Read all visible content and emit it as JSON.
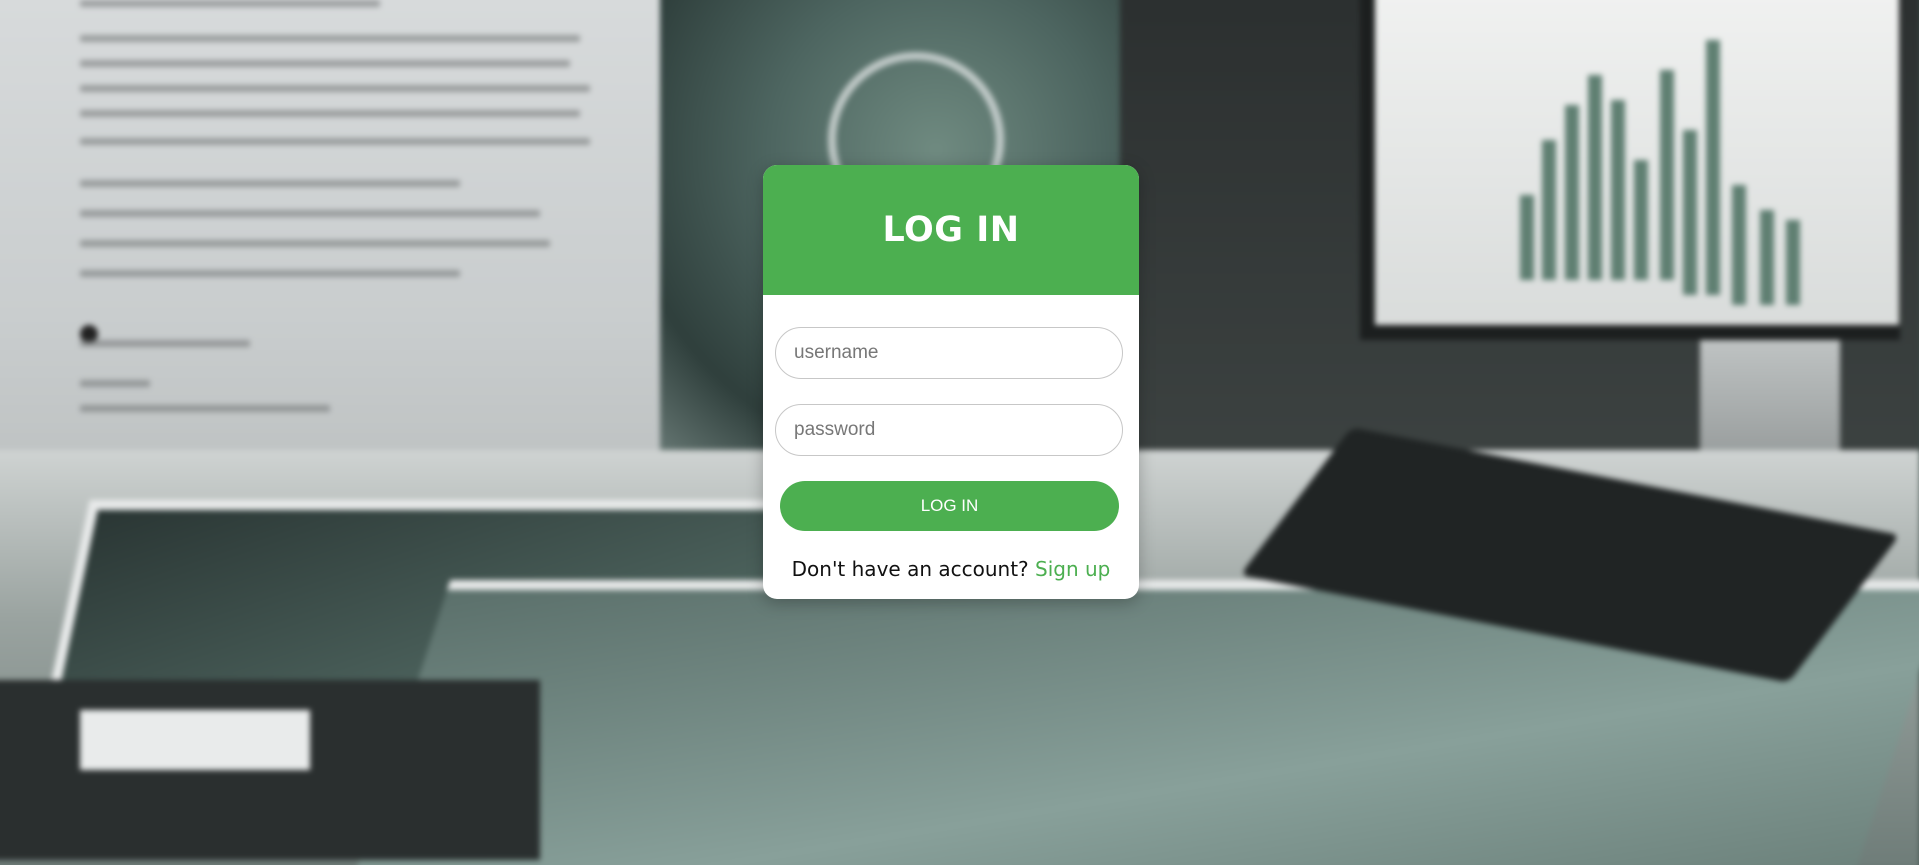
{
  "login": {
    "title": "LOG IN",
    "username_placeholder": "username",
    "password_placeholder": "password",
    "submit_label": "LOG IN",
    "signup_prompt": "Don't have an account?",
    "signup_link": "Sign up"
  },
  "colors": {
    "accent": "#4caf50",
    "card_background": "#ffffff"
  }
}
